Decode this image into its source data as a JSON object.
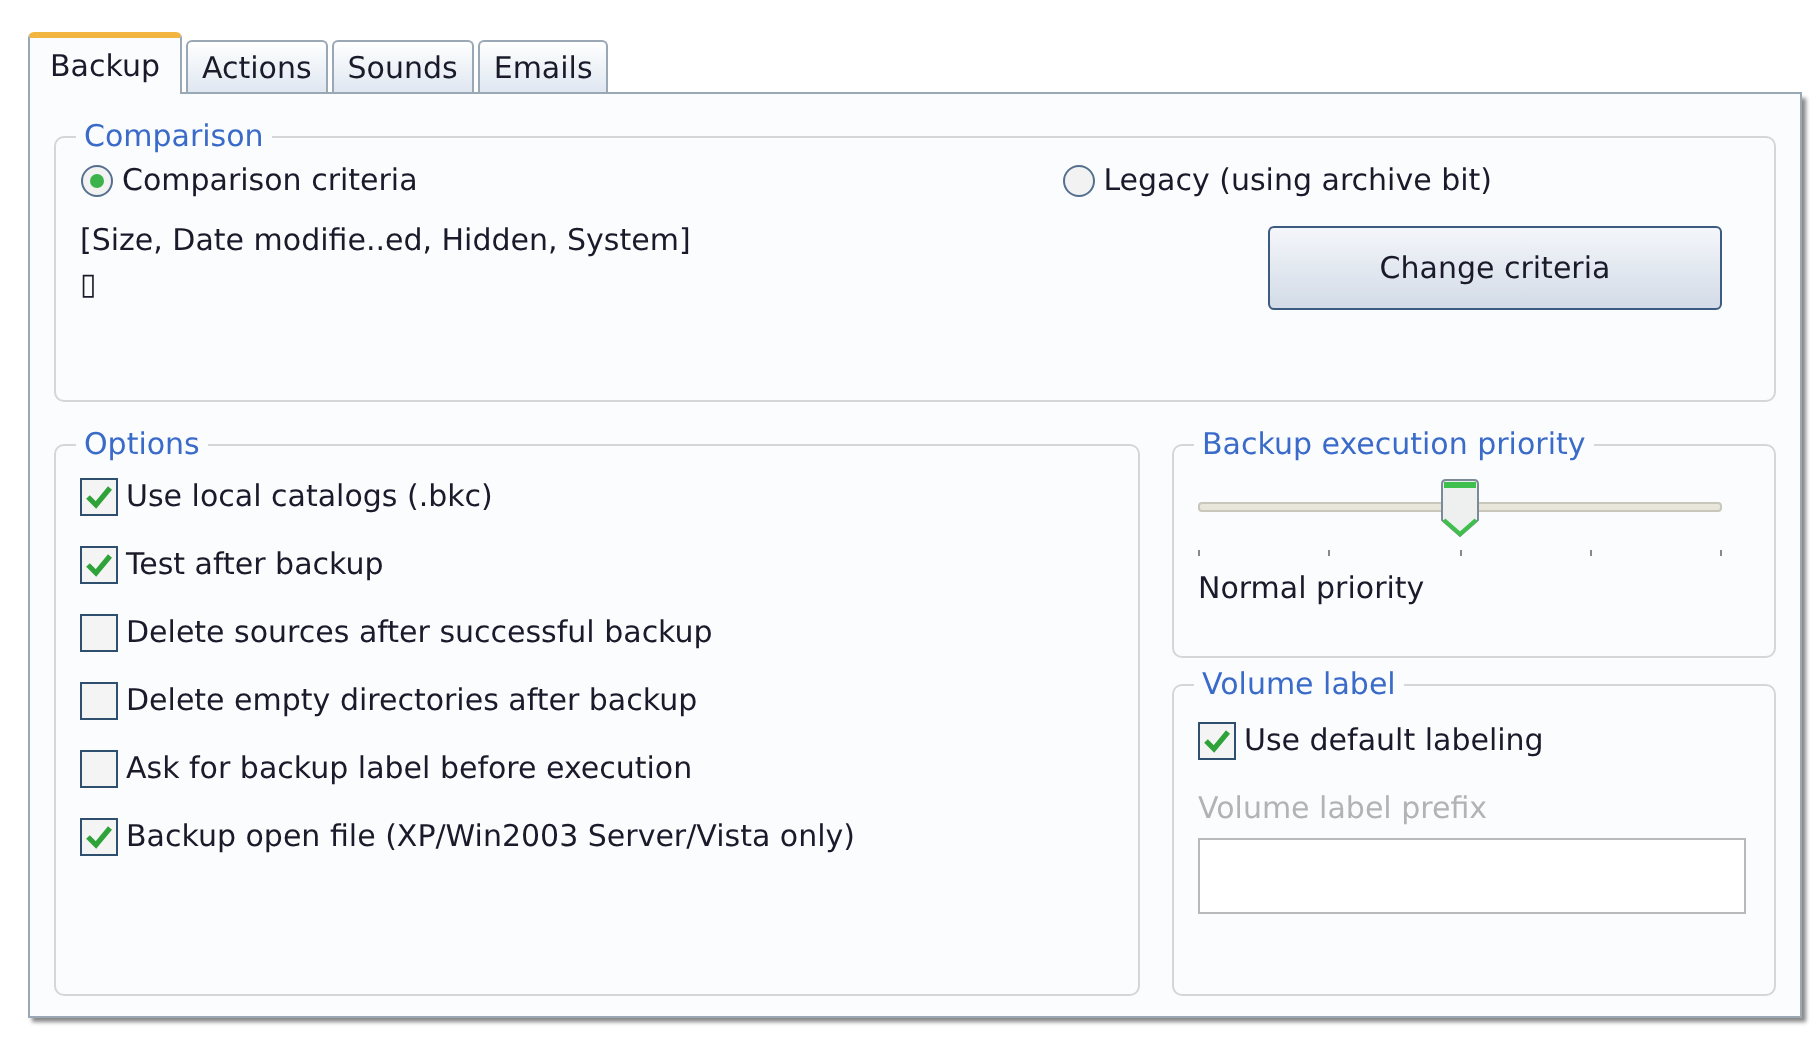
{
  "tabs": [
    {
      "label": "Backup",
      "selected": true
    },
    {
      "label": "Actions",
      "selected": false
    },
    {
      "label": "Sounds",
      "selected": false
    },
    {
      "label": "Emails",
      "selected": false
    }
  ],
  "comparison": {
    "title": "Comparison",
    "options": [
      {
        "label": "Comparison criteria",
        "selected": true
      },
      {
        "label": "Legacy (using archive bit)",
        "selected": false
      }
    ],
    "criteria_lines": [
      "[Size, Date modifie..ed, Hidden, System]",
      "▯"
    ],
    "button": "Change criteria"
  },
  "options": {
    "title": "Options",
    "items": [
      {
        "label": "Use local catalogs (.bkc)",
        "checked": true
      },
      {
        "label": "Test after backup",
        "checked": true
      },
      {
        "label": "Delete sources after successful backup",
        "checked": false
      },
      {
        "label": "Delete empty directories after backup",
        "checked": false
      },
      {
        "label": "Ask for backup label before execution",
        "checked": false
      },
      {
        "label": "Backup open file (XP/Win2003 Server/Vista only)",
        "checked": true
      }
    ]
  },
  "priority": {
    "title": "Backup execution priority",
    "level": 0.5,
    "reading": "Normal priority"
  },
  "volume_label": {
    "title": "Volume label",
    "use_default": {
      "label": "Use default labeling",
      "checked": true
    },
    "prefix_label": "Volume label prefix",
    "prefix_disabled": true
  }
}
